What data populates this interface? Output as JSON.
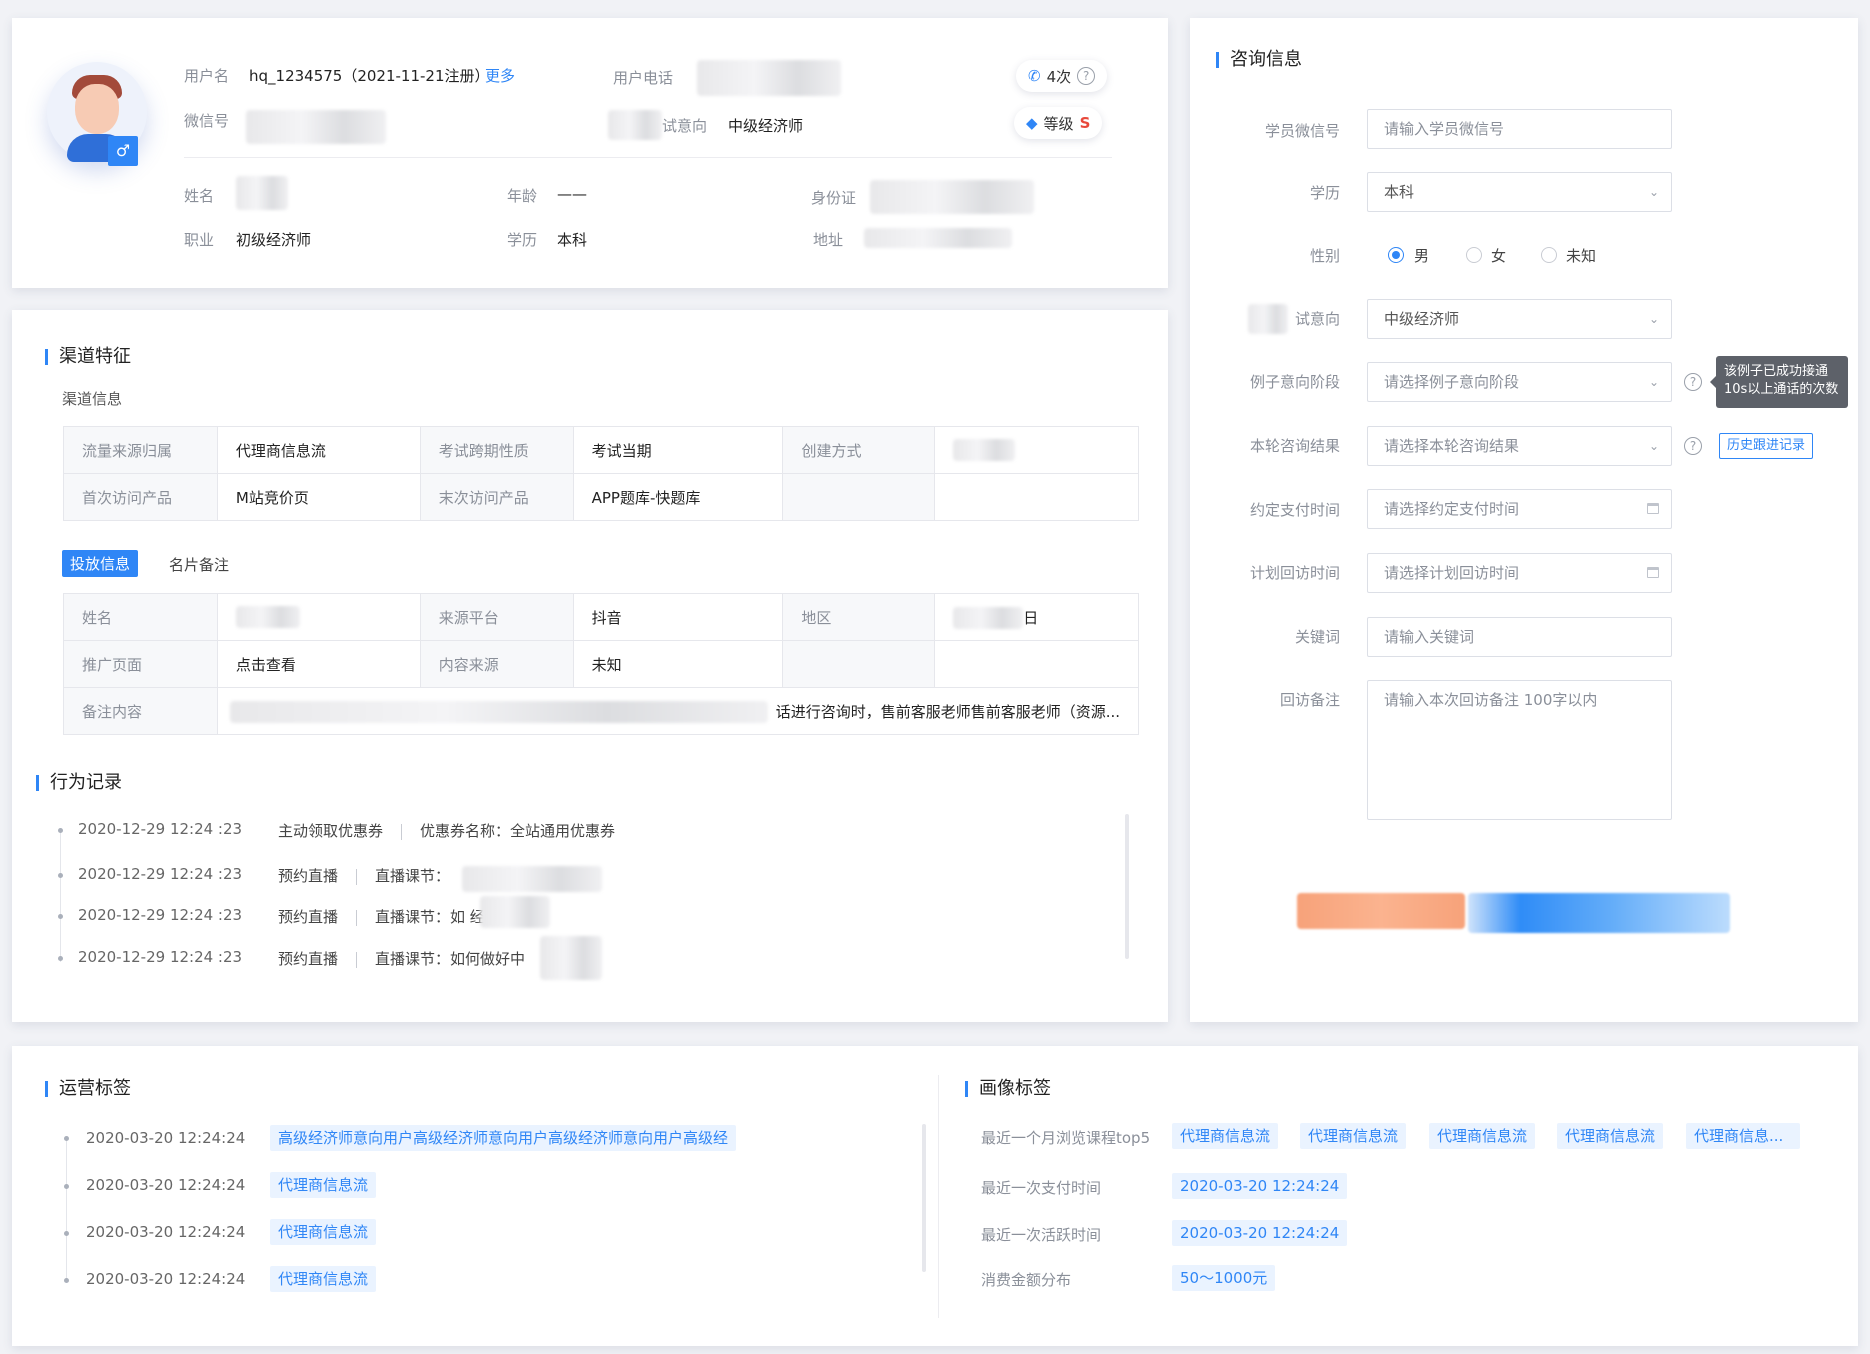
{
  "profile": {
    "username_label": "用户名",
    "username_value": "hq_1234575（2021-11-21注册）",
    "more_link": "更多",
    "phone_label": "用户电话",
    "wechat_label": "微信号",
    "exam_intent_label": "试意向",
    "exam_intent_value": "中级经济师",
    "call_count": "4次",
    "level_label": "等级",
    "level_value": "S",
    "gender_symbol": "♂",
    "name_label": "姓名",
    "age_label": "年龄",
    "age_value": "——",
    "id_label": "身份证",
    "job_label": "职业",
    "job_value": "初级经济师",
    "edu_label": "学历",
    "edu_value": "本科",
    "address_label": "地址"
  },
  "channel": {
    "title": "渠道特征",
    "subtitle": "渠道信息",
    "table": [
      [
        "流量来源归属",
        "代理商信息流",
        "考试跨期性质",
        "考试当期",
        "创建方式",
        ""
      ],
      [
        "首次访问产品",
        "M站竞价页",
        "末次访问产品",
        "APP题库-快题库",
        "",
        ""
      ]
    ],
    "tabs": [
      "投放信息",
      "名片备注"
    ],
    "ad_table": {
      "row1": [
        "姓名",
        "",
        "来源平台",
        "抖音",
        "地区",
        "日"
      ],
      "row2": [
        "推广页面",
        "点击查看",
        "内容来源",
        "未知",
        "",
        ""
      ],
      "row3": [
        "备注内容",
        "话进行咨询时，售前客服老师售前客服老师（资源..."
      ]
    }
  },
  "behavior": {
    "title": "行为记录",
    "items": [
      {
        "time": "2020-12-29 12:24 :23",
        "action": "主动领取优惠券",
        "detail": "优惠券名称：全站通用优惠券"
      },
      {
        "time": "2020-12-29 12:24 :23",
        "action": "预约直播",
        "detail": "直播课节："
      },
      {
        "time": "2020-12-29 12:24 :23",
        "action": "预约直播",
        "detail": "直播课节：如                 经备考?"
      },
      {
        "time": "2020-12-29 12:24 :23",
        "action": "预约直播",
        "detail": "直播课节：如何做好中"
      }
    ]
  },
  "consult": {
    "title": "咨询信息",
    "wechat_label": "学员微信号",
    "wechat_placeholder": "请输入学员微信号",
    "edu_label": "学历",
    "edu_value": "本科",
    "gender_label": "性别",
    "gender_options": [
      "男",
      "女",
      "未知"
    ],
    "intent_label": "试意向",
    "intent_value": "中级经济师",
    "stage_label": "例子意向阶段",
    "stage_placeholder": "请选择例子意向阶段",
    "tooltip_line1": "该例子已成功接通",
    "tooltip_line2": "10s以上通话的次数",
    "result_label": "本轮咨询结果",
    "result_placeholder": "请选择本轮咨询结果",
    "history_button": "历史跟进记录",
    "pay_label": "约定支付时间",
    "pay_placeholder": "请选择约定支付时间",
    "revisit_label": "计划回访时间",
    "revisit_placeholder": "请选择计划回访时间",
    "keyword_label": "关键词",
    "keyword_placeholder": "请输入关键词",
    "note_label": "回访备注",
    "note_placeholder": "请输入本次回访备注 100字以内"
  },
  "ops_tags": {
    "title": "运营标签",
    "items": [
      {
        "time": "2020-03-20 12:24:24",
        "tag": "高级经济师意向用户高级经济师意向用户高级经济师意向用户高级经"
      },
      {
        "time": "2020-03-20 12:24:24",
        "tag": "代理商信息流"
      },
      {
        "time": "2020-03-20 12:24:24",
        "tag": "代理商信息流"
      },
      {
        "time": "2020-03-20 12:24:24",
        "tag": "代理商信息流"
      }
    ]
  },
  "portrait_tags": {
    "title": "画像标签",
    "top5_label": "最近一个月浏览课程top5",
    "top5_tags": [
      "代理商信息流",
      "代理商信息流",
      "代理商信息流",
      "代理商信息流",
      "代理商信息..."
    ],
    "last_pay_label": "最近一次支付时间",
    "last_pay_value": "2020-03-20 12:24:24",
    "last_active_label": "最近一次活跃时间",
    "last_active_value": "2020-03-20 12:24:24",
    "spend_label": "消费金额分布",
    "spend_value": "50～1000元"
  },
  "colors": {
    "accent": "#2f86f6",
    "level_badge": "#e8483b",
    "orange_button": "#f6a27a"
  }
}
